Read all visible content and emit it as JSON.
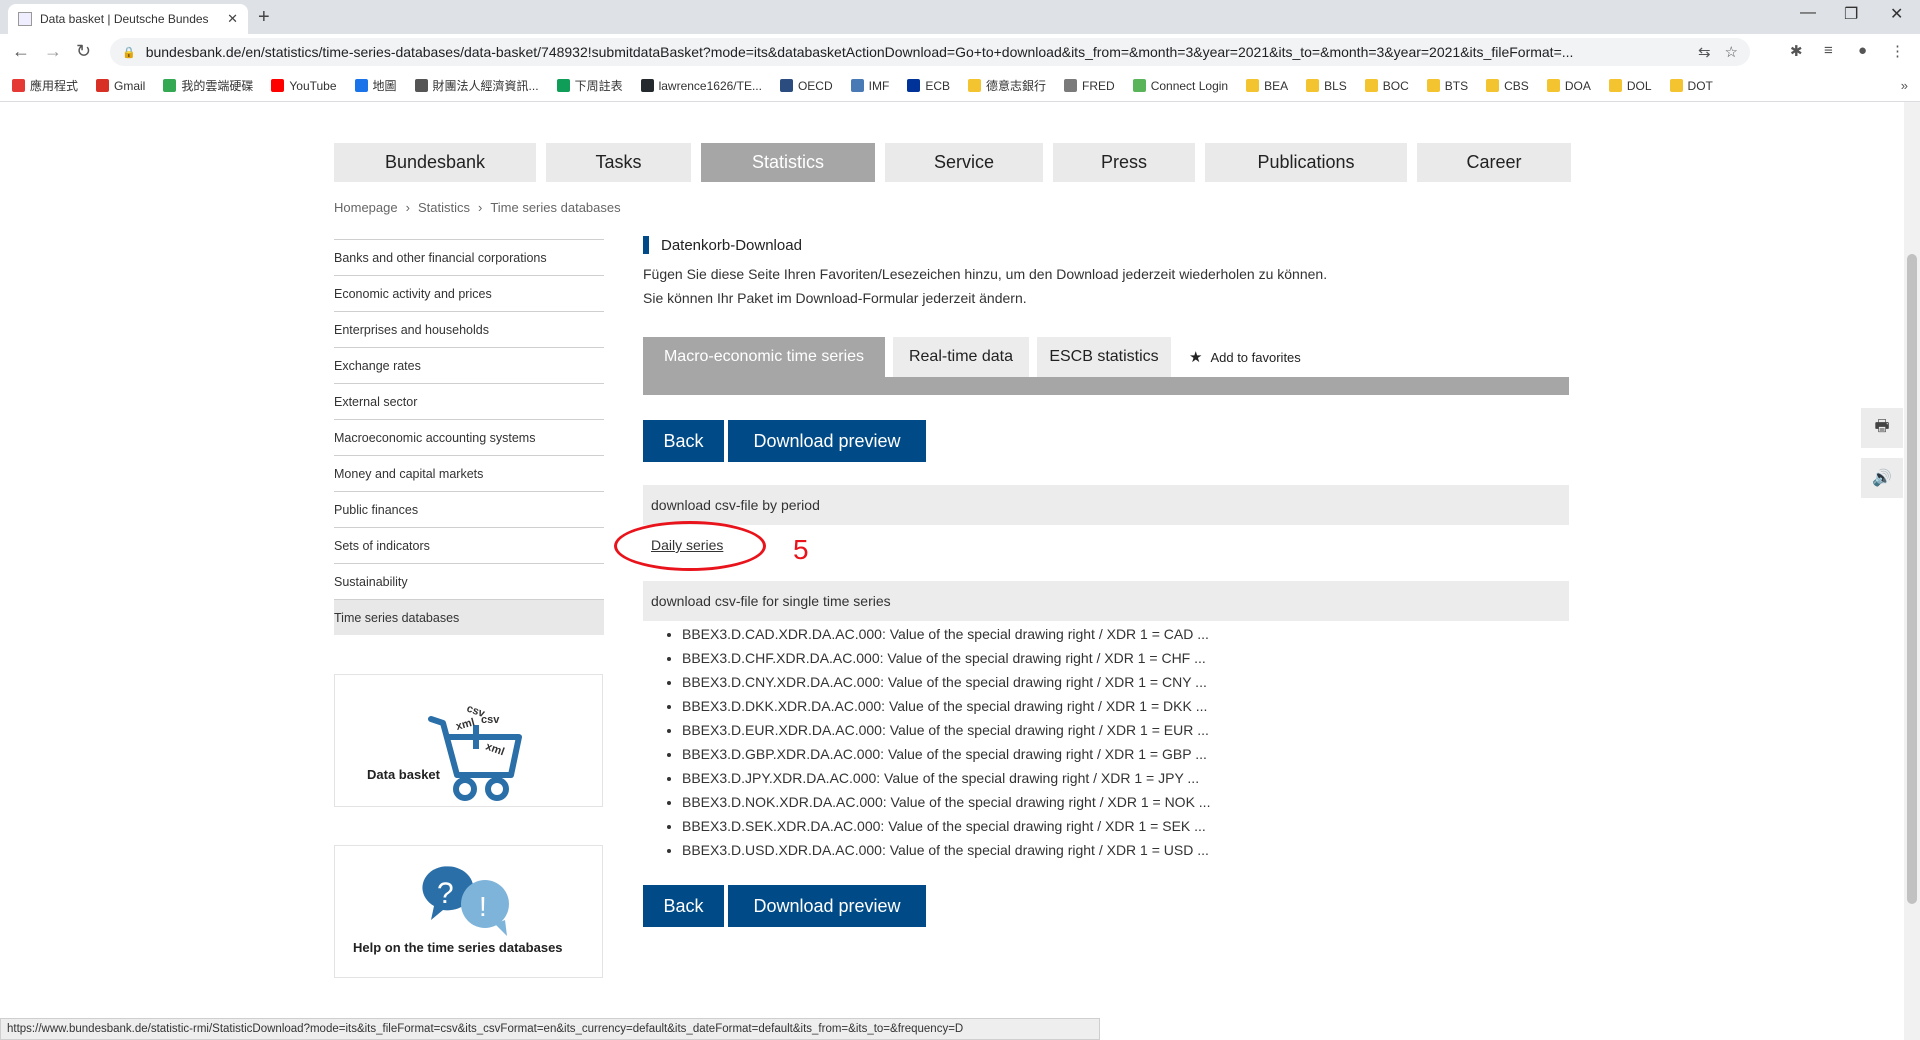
{
  "browser": {
    "tab_title": "Data basket | Deutsche Bundes",
    "url": "bundesbank.de/en/statistics/time-series-databases/data-basket/748932!submitdataBasket?mode=its&databasketActionDownload=Go+to+download&its_from=&month=3&year=2021&its_to=&month=3&year=2021&its_fileFormat=...",
    "bookmarks": [
      {
        "label": "應用程式",
        "color": "#e53935"
      },
      {
        "label": "Gmail",
        "color": "#d93025"
      },
      {
        "label": "我的雲端硬碟",
        "color": "#34a853"
      },
      {
        "label": "YouTube",
        "color": "#ff0000"
      },
      {
        "label": "地圖",
        "color": "#1a73e8"
      },
      {
        "label": "財團法人經濟資訊...",
        "color": "#555555"
      },
      {
        "label": "下周註表",
        "color": "#0f9d58"
      },
      {
        "label": "lawrence1626/TE...",
        "color": "#24292e"
      },
      {
        "label": "OECD",
        "color": "#2b4c7e"
      },
      {
        "label": "IMF",
        "color": "#4a7ab5"
      },
      {
        "label": "ECB",
        "color": "#003399"
      },
      {
        "label": "德意志銀行",
        "color": "#f4c430"
      },
      {
        "label": "FRED",
        "color": "#7a7a7a"
      },
      {
        "label": "Connect Login",
        "color": "#5ab45a"
      },
      {
        "label": "BEA",
        "color": "#f4c430"
      },
      {
        "label": "BLS",
        "color": "#f4c430"
      },
      {
        "label": "BOC",
        "color": "#f4c430"
      },
      {
        "label": "BTS",
        "color": "#f4c430"
      },
      {
        "label": "CBS",
        "color": "#f4c430"
      },
      {
        "label": "DOA",
        "color": "#f4c430"
      },
      {
        "label": "DOL",
        "color": "#f4c430"
      },
      {
        "label": "DOT",
        "color": "#f4c430"
      }
    ],
    "status_url": "https://www.bundesbank.de/statistic-rmi/StatisticDownload?mode=its&its_fileFormat=csv&its_csvFormat=en&its_currency=default&its_dateFormat=default&its_from=&its_to=&frequency=D"
  },
  "nav": [
    "Bundesbank",
    "Tasks",
    "Statistics",
    "Service",
    "Press",
    "Publications",
    "Career"
  ],
  "breadcrumb": [
    "Homepage",
    "Statistics",
    "Time series databases"
  ],
  "sidebar": [
    "Banks and other financial corporations",
    "Economic activity and prices",
    "Enterprises and households",
    "Exchange rates",
    "External sector",
    "Macroeconomic accounting systems",
    "Money and capital markets",
    "Public finances",
    "Sets of indicators",
    "Sustainability",
    "Time series databases"
  ],
  "promos": {
    "basket_label": "Data basket",
    "basket_tags": [
      "csv",
      "xml",
      "csv",
      "xml"
    ],
    "help_label": "Help on the time series databases"
  },
  "content": {
    "heading": "Datenkorb-Download",
    "line1": "Fügen Sie diese Seite Ihren Favoriten/Lesezeichen hinzu, um den Download jederzeit wiederholen zu können.",
    "line2": "Sie können Ihr Paket im Download-Formular jederzeit ändern.",
    "tabs": [
      "Macro-economic time series",
      "Real-time data",
      "ESCB statistics"
    ],
    "add_favorites": "Add to favorites",
    "back_label": "Back",
    "preview_label": "Download preview",
    "period_head": "download csv-file by period",
    "daily_link": "Daily series",
    "single_head": "download csv-file for single time series",
    "series": [
      "BBEX3.D.CAD.XDR.DA.AC.000: Value of the special drawing right / XDR 1 = CAD ...",
      "BBEX3.D.CHF.XDR.DA.AC.000: Value of the special drawing right / XDR 1 = CHF ...",
      "BBEX3.D.CNY.XDR.DA.AC.000: Value of the special drawing right / XDR 1 = CNY ...",
      "BBEX3.D.DKK.XDR.DA.AC.000: Value of the special drawing right / XDR 1 = DKK ...",
      "BBEX3.D.EUR.XDR.DA.AC.000: Value of the special drawing right / XDR 1 = EUR ...",
      "BBEX3.D.GBP.XDR.DA.AC.000: Value of the special drawing right / XDR 1 = GBP ...",
      "BBEX3.D.JPY.XDR.DA.AC.000: Value of the special drawing right / XDR 1 = JPY ...",
      "BBEX3.D.NOK.XDR.DA.AC.000: Value of the special drawing right / XDR 1 = NOK ...",
      "BBEX3.D.SEK.XDR.DA.AC.000: Value of the special drawing right / XDR 1 = SEK ...",
      "BBEX3.D.USD.XDR.DA.AC.000: Value of the special drawing right / XDR 1 = USD ..."
    ]
  },
  "annotation": {
    "number": "5",
    "color": "#e8131b"
  },
  "colors": {
    "brand_blue": "#004b87",
    "nav_active": "#a6a6a6"
  }
}
